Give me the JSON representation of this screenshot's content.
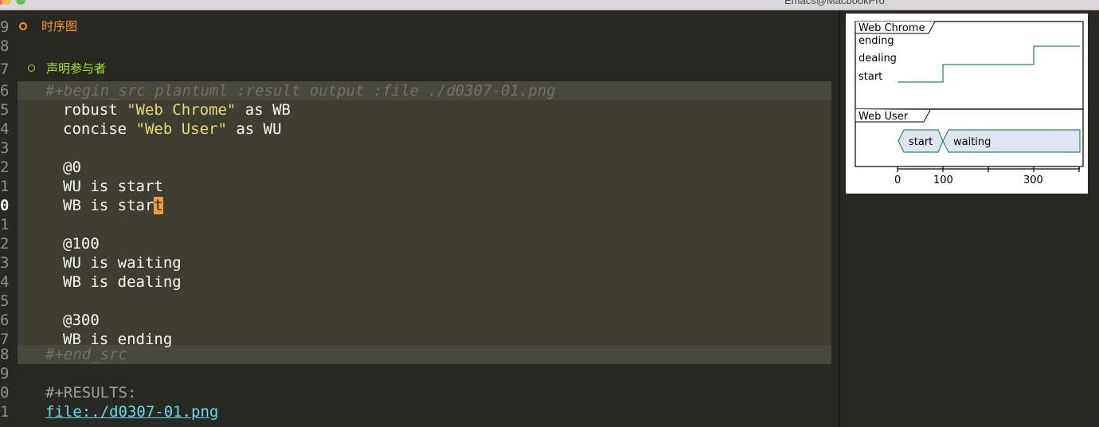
{
  "window": {
    "title": "Emacs@MacbookPro"
  },
  "editor": {
    "heading1": {
      "line_number": "9",
      "text": "时序图",
      "color": "#fd971f"
    },
    "heading2": {
      "line_number": "7",
      "text": "声明参与者",
      "color": "#a6e22e"
    },
    "lines": [
      {
        "num": "8",
        "text": ""
      },
      {
        "num": "6",
        "begin": "#+begin_src plantuml :result output :file ./d0307-01.png"
      },
      {
        "num": "5",
        "kw1": "robust ",
        "str": "\"Web Chrome\"",
        "kw2": " as WB"
      },
      {
        "num": "4",
        "kw1": "concise ",
        "str": "\"Web User\"",
        "kw2": " as WU"
      },
      {
        "num": "3",
        "text": ""
      },
      {
        "num": "2",
        "text": "@0"
      },
      {
        "num": "1",
        "text": "WU is start"
      },
      {
        "num": "0",
        "text_before": "WB is star",
        "cursor_char": "t"
      },
      {
        "num": "1",
        "text": ""
      },
      {
        "num": "2",
        "text": "@100"
      },
      {
        "num": "3",
        "text": "WU is waiting"
      },
      {
        "num": "4",
        "text": "WB is dealing"
      },
      {
        "num": "5",
        "text": ""
      },
      {
        "num": "6",
        "text": "@300"
      },
      {
        "num": "7",
        "text": "WB is ending"
      },
      {
        "num": "8",
        "end": "#+end_src"
      },
      {
        "num": "9",
        "text": ""
      },
      {
        "num": "0",
        "results": "#+RESULTS:"
      },
      {
        "num": "1",
        "link": "file:./d0307-01.png"
      }
    ]
  },
  "diagram": {
    "robust": {
      "name": "Web Chrome",
      "states": [
        "ending",
        "dealing",
        "start"
      ],
      "changes": [
        {
          "at": 0,
          "state": "start"
        },
        {
          "at": 100,
          "state": "dealing"
        },
        {
          "at": 300,
          "state": "ending"
        }
      ]
    },
    "concise": {
      "name": "Web User",
      "states": [
        "start",
        "waiting"
      ],
      "changes": [
        {
          "at": 0,
          "state": "start"
        },
        {
          "at": 100,
          "state": "waiting"
        }
      ]
    },
    "axis": {
      "ticks": [
        "0",
        "100",
        "300"
      ]
    },
    "colors": {
      "line": "#2e8b57",
      "fill": "#dfe4f2",
      "frame": "#000000"
    }
  }
}
